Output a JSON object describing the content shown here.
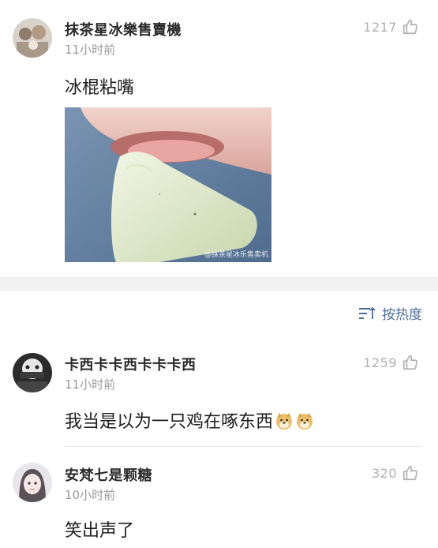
{
  "top_comment": {
    "username": "抹茶星冰樂售賣機",
    "time": "11小时前",
    "likes": "1217",
    "text": "冰棍粘嘴",
    "image_watermark": "@抹茶星冰乐售卖机"
  },
  "sort": {
    "label": "按热度"
  },
  "comments": [
    {
      "username": "卡西卡卡西卡卡卡西",
      "time": "11小时前",
      "likes": "1259",
      "text": "我当是以为一只鸡在啄东西",
      "emojis": [
        "doge-emoji",
        "doge-emoji"
      ]
    },
    {
      "username": "安梵七是颗糖",
      "time": "10小时前",
      "likes": "320",
      "text": "笑出声了"
    }
  ],
  "colors": {
    "accent": "#4f6d98",
    "like_gray": "#b0b0b0",
    "time_gray": "#9a9a9a",
    "section_gap": "#f2f2f2"
  }
}
